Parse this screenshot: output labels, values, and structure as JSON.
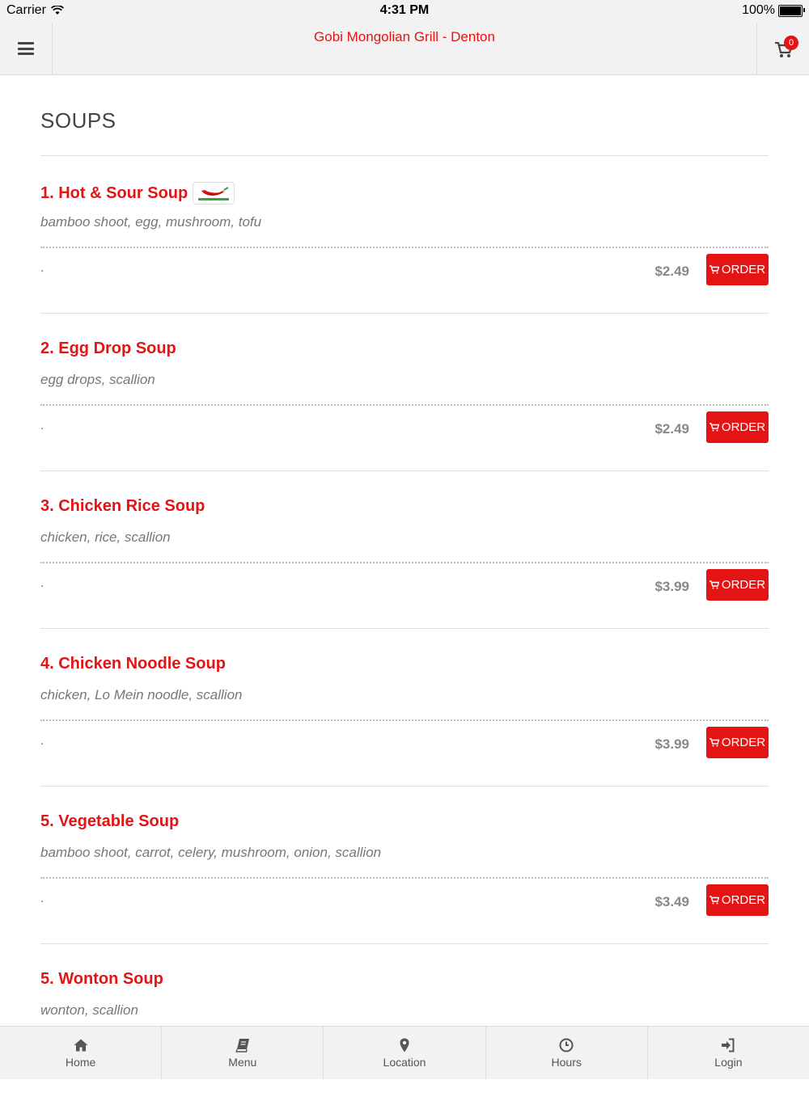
{
  "status_bar": {
    "carrier": "Carrier",
    "time": "4:31 PM",
    "battery": "100%"
  },
  "header": {
    "title": "Gobi Mongolian Grill - Denton",
    "cart_count": "0",
    "menu_icon": "hamburger-icon",
    "cart_icon": "cart-icon"
  },
  "section": {
    "title": "SOUPS"
  },
  "items": [
    {
      "name": "1. Hot & Sour Soup",
      "desc": "bamboo shoot, egg, mushroom, tofu",
      "mark": ".",
      "price": "$2.49",
      "order_label": "ORDER",
      "spicy": true
    },
    {
      "name": "2. Egg Drop Soup",
      "desc": "egg drops, scallion",
      "mark": ".",
      "price": "$2.49",
      "order_label": "ORDER"
    },
    {
      "name": "3. Chicken Rice Soup",
      "desc": "chicken, rice, scallion",
      "mark": ".",
      "price": "$3.99",
      "order_label": "ORDER"
    },
    {
      "name": "4. Chicken Noodle Soup",
      "desc": "chicken, Lo Mein noodle, scallion",
      "mark": ".",
      "price": "$3.99",
      "order_label": "ORDER"
    },
    {
      "name": "5. Vegetable Soup",
      "desc": "bamboo shoot, carrot, celery, mushroom, onion, scallion",
      "mark": ".",
      "price": "$3.49",
      "order_label": "ORDER"
    },
    {
      "name": "5. Wonton Soup",
      "desc": "wonton, scallion"
    }
  ],
  "tabs": [
    {
      "label": "Home",
      "icon": "home-icon"
    },
    {
      "label": "Menu",
      "icon": "book-icon"
    },
    {
      "label": "Location",
      "icon": "map-pin-icon"
    },
    {
      "label": "Hours",
      "icon": "clock-icon"
    },
    {
      "label": "Login",
      "icon": "sign-in-icon"
    }
  ],
  "colors": {
    "accent": "#e41414",
    "header_bg": "#f2f2f2",
    "price": "#888888"
  }
}
